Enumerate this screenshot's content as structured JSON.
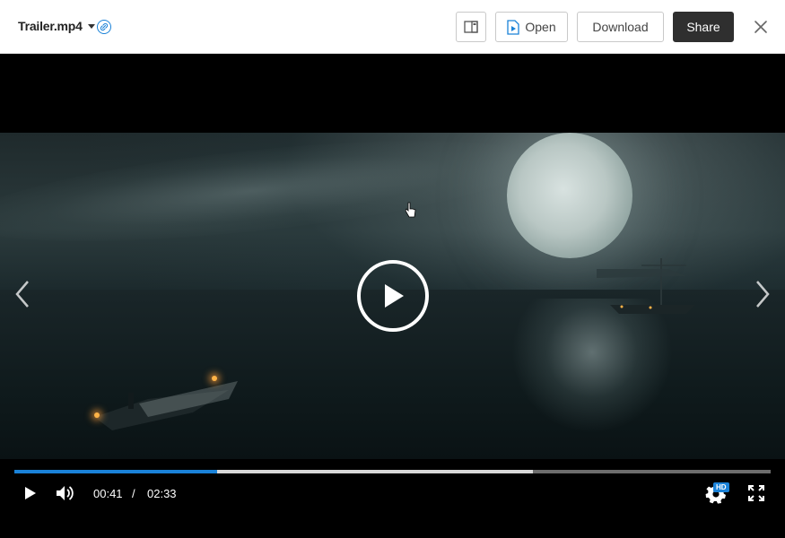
{
  "header": {
    "file_name": "Trailer.mp4",
    "open_label": "Open",
    "download_label": "Download",
    "share_label": "Share"
  },
  "icons": {
    "link": "link-icon",
    "panel": "side-panel-icon",
    "open": "play-document-icon",
    "close": "close-icon",
    "prev": "chevron-left-icon",
    "next": "chevron-right-icon",
    "play": "play-icon",
    "volume": "volume-icon",
    "settings": "gear-icon",
    "fullscreen": "fullscreen-icon"
  },
  "player": {
    "current_time": "00:41",
    "separator": "/",
    "total_time": "02:33",
    "quality_badge": "HD",
    "played_fraction": 0.268,
    "buffered_fraction": 0.686
  },
  "colors": {
    "accent": "#1a82d8",
    "share_button": "#2f2f2f"
  }
}
